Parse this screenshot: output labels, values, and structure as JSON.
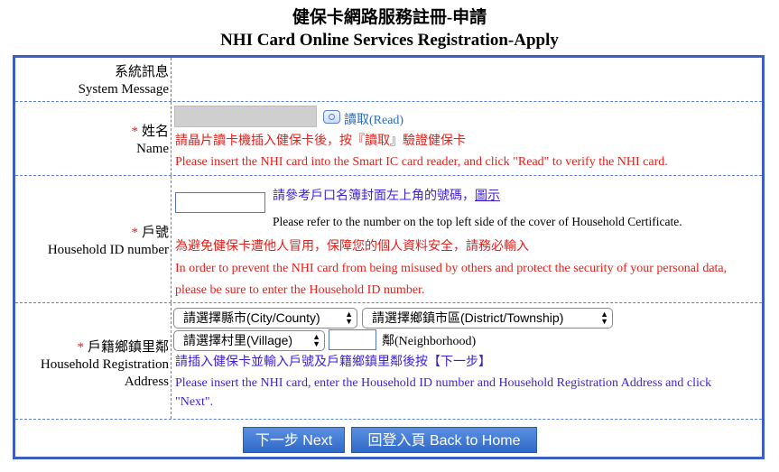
{
  "header": {
    "title_zh": "健保卡網路服務註冊-申請",
    "title_en": "NHI Card Online Services Registration-Apply"
  },
  "rows": {
    "system_message": {
      "label_zh": "系統訊息",
      "label_en": "System Message"
    },
    "name": {
      "required_mark": "*",
      "label_zh": "姓名",
      "label_en": "Name",
      "read_button_label": "讀取(Read)",
      "hint_zh": "請晶片讀卡機插入健保卡後，按『讀取』驗證健保卡",
      "hint_en": "Please insert the NHI card into the Smart IC card reader, and click \"Read\" to verify the NHI card."
    },
    "household_id": {
      "required_mark": "*",
      "label_zh": "戶號",
      "label_en": "Household ID number",
      "refer_zh": "請參考戶口名簿封面左上角的號碼，",
      "example_link": "圖示",
      "refer_en": "Please refer to the number on the top left side of the cover of Household Certificate.",
      "warn_zh": "為避免健保卡遭他人冒用，保障您的個人資料安全，請務必輸入",
      "warn_en_line1": "In order to prevent the NHI card from being misused by others and protect the security of your personal data,",
      "warn_en_line2": "please be sure to enter the Household ID number.",
      "input_value": ""
    },
    "address": {
      "required_mark": "*",
      "label_zh": "戶籍鄉鎮里鄰",
      "label_en_line1": "Household Registration",
      "label_en_line2": "Address",
      "city_select": "請選擇縣市(City/County)",
      "district_select": "請選擇鄉鎮市區(District/Township)",
      "village_select": "請選擇村里(Village)",
      "neighborhood_value": "",
      "neighborhood_label": "鄰(Neighborhood)",
      "hint_zh": "請插入健保卡並輸入戶號及戶籍鄉鎮里鄰後按【下一步】",
      "hint_en_line1": "Please insert the NHI card, enter the Household ID number and Household Registration Address and click",
      "hint_en_line2": "\"Next\"."
    }
  },
  "buttons": {
    "next": "下一步 Next",
    "home": "回登入頁 Back to Home"
  }
}
